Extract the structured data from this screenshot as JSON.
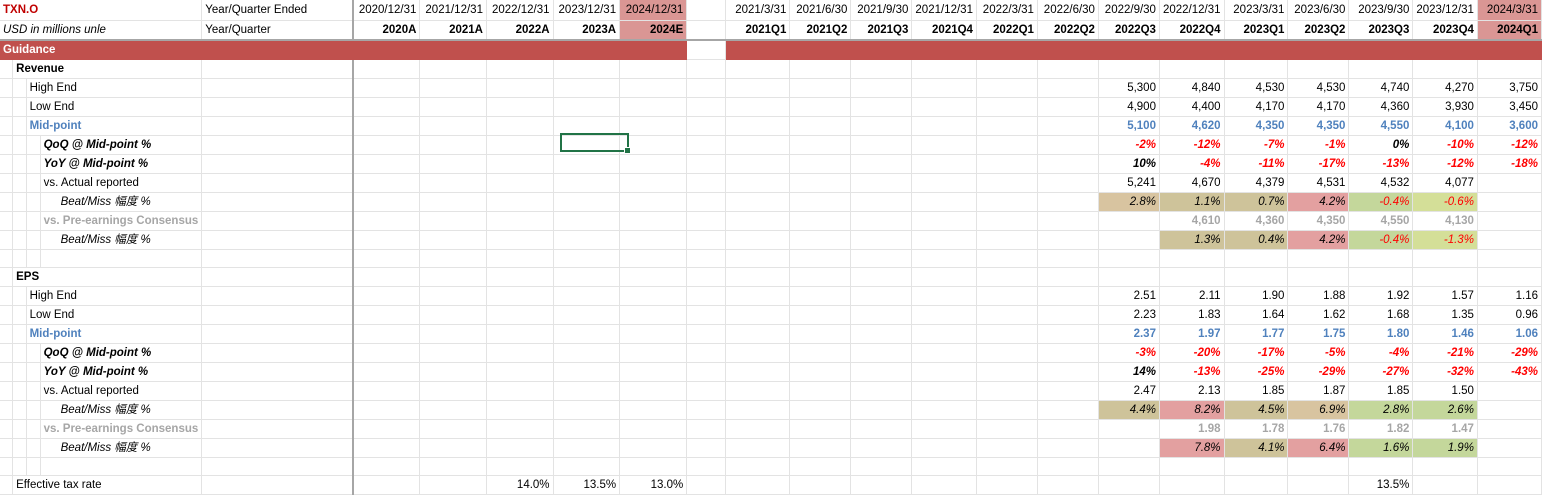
{
  "sheet": {
    "ticker": "TXN.O",
    "units_note": "USD in millions unle",
    "period_row_label": "Year/Quarter Ended",
    "code_row_label": "Year/Quarter",
    "section_title": "Guidance"
  },
  "annual_dates": [
    "2020/12/31",
    "2021/12/31",
    "2022/12/31",
    "2023/12/31",
    "2024/12/31"
  ],
  "annual_codes": [
    "2020A",
    "2021A",
    "2022A",
    "2023A",
    "2024E"
  ],
  "quarter_dates": [
    "2021/3/31",
    "2021/6/30",
    "2021/9/30",
    "2021/12/31",
    "2022/3/31",
    "2022/6/30",
    "2022/9/30",
    "2022/12/31",
    "2023/3/31",
    "2023/6/30",
    "2023/9/30",
    "2023/12/31",
    "2024/3/31"
  ],
  "quarter_codes": [
    "2021Q1",
    "2021Q2",
    "2021Q3",
    "2021Q4",
    "2022Q1",
    "2022Q2",
    "2022Q3",
    "2022Q4",
    "2023Q1",
    "2023Q2",
    "2023Q3",
    "2023Q4",
    "2024Q1"
  ],
  "revenue": {
    "heading": "Revenue",
    "high_end": {
      "label": "High End",
      "values": [
        "5,300",
        "4,840",
        "4,530",
        "4,530",
        "4,740",
        "4,270",
        "3,750"
      ]
    },
    "low_end": {
      "label": "Low End",
      "values": [
        "4,900",
        "4,400",
        "4,170",
        "4,170",
        "4,360",
        "3,930",
        "3,450"
      ]
    },
    "mid_point": {
      "label": "Mid-point",
      "values": [
        "5,100",
        "4,620",
        "4,350",
        "4,350",
        "4,550",
        "4,100",
        "3,600"
      ]
    },
    "qoq": {
      "label": "QoQ @ Mid-point %",
      "values": [
        "-2%",
        "-12%",
        "-7%",
        "-1%",
        "0%",
        "-10%",
        "-12%"
      ]
    },
    "yoy": {
      "label": "YoY @ Mid-point %",
      "values": [
        "10%",
        "-4%",
        "-11%",
        "-17%",
        "-13%",
        "-12%",
        "-18%"
      ]
    },
    "actual": {
      "label": "vs. Actual reported",
      "values": [
        "5,241",
        "4,670",
        "4,379",
        "4,531",
        "4,532",
        "4,077"
      ]
    },
    "beat_miss_1": {
      "label": "Beat/Miss 幅度 %",
      "values": [
        "2.8%",
        "1.1%",
        "0.7%",
        "4.2%",
        "-0.4%",
        "-0.6%"
      ]
    },
    "consensus": {
      "label": "vs. Pre-earnings Consensus",
      "values": [
        "4,610",
        "4,360",
        "4,350",
        "4,550",
        "4,130"
      ]
    },
    "beat_miss_2": {
      "label": "Beat/Miss 幅度 %",
      "values": [
        "1.3%",
        "0.4%",
        "4.2%",
        "-0.4%",
        "-1.3%"
      ]
    }
  },
  "eps": {
    "heading": "EPS",
    "high_end": {
      "label": "High End",
      "values": [
        "2.51",
        "2.11",
        "1.90",
        "1.88",
        "1.92",
        "1.57",
        "1.16"
      ]
    },
    "low_end": {
      "label": "Low End",
      "values": [
        "2.23",
        "1.83",
        "1.64",
        "1.62",
        "1.68",
        "1.35",
        "0.96"
      ]
    },
    "mid_point": {
      "label": "Mid-point",
      "values": [
        "2.37",
        "1.97",
        "1.77",
        "1.75",
        "1.80",
        "1.46",
        "1.06"
      ]
    },
    "qoq": {
      "label": "QoQ @ Mid-point %",
      "values": [
        "-3%",
        "-20%",
        "-17%",
        "-5%",
        "-4%",
        "-21%",
        "-29%"
      ]
    },
    "yoy": {
      "label": "YoY @ Mid-point %",
      "values": [
        "14%",
        "-13%",
        "-25%",
        "-29%",
        "-27%",
        "-32%",
        "-43%"
      ]
    },
    "actual": {
      "label": "vs. Actual reported",
      "values": [
        "2.47",
        "2.13",
        "1.85",
        "1.87",
        "1.85",
        "1.50"
      ]
    },
    "beat_miss_1": {
      "label": "Beat/Miss 幅度 %",
      "values": [
        "4.4%",
        "8.2%",
        "4.5%",
        "6.9%",
        "2.8%",
        "2.6%"
      ]
    },
    "consensus": {
      "label": "vs. Pre-earnings Consensus",
      "values": [
        "1.98",
        "1.78",
        "1.76",
        "1.82",
        "1.47"
      ]
    },
    "beat_miss_2": {
      "label": "Beat/Miss 幅度 %",
      "values": [
        "7.8%",
        "4.1%",
        "6.4%",
        "1.6%",
        "1.9%"
      ]
    }
  },
  "tax": {
    "label": "Effective tax rate",
    "annual_values": [
      "14.0%",
      "13.5%",
      "13.0%"
    ],
    "quarter_value": "13.5%"
  },
  "colors": {
    "ticker_red": "#c00000",
    "guidance_band": "#c0504d",
    "highlight_pink": "#da9694",
    "mid_point_blue": "#4f81bd",
    "negative_red": "#ff0000",
    "beat_tan": "#d8c4a0",
    "beat_khaki": "#cec39a",
    "beat_pink": "#e3a0a0",
    "beat_green": "#c4d79b",
    "selection_green": "#217346"
  }
}
